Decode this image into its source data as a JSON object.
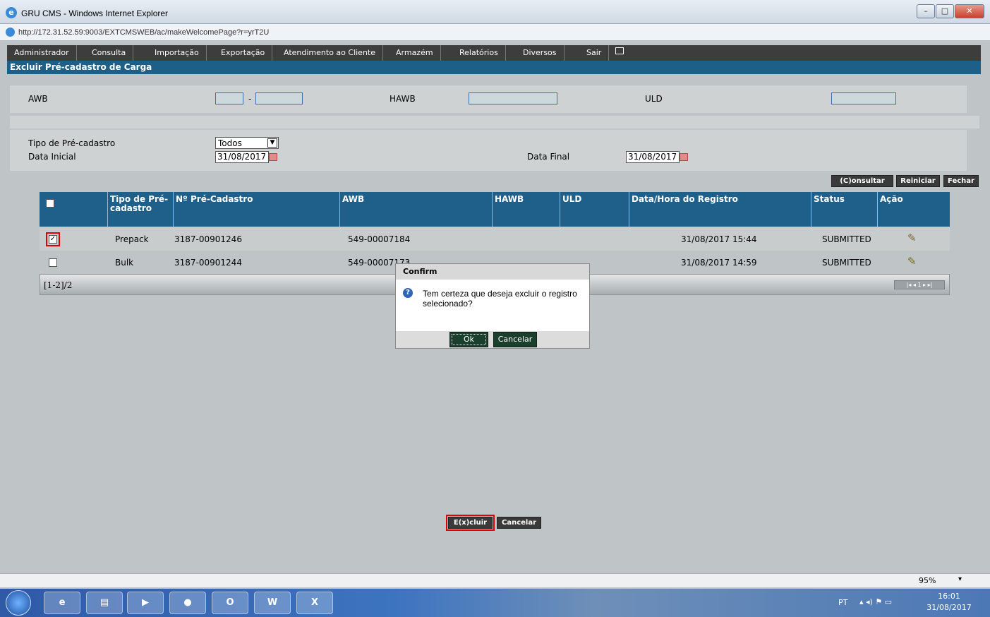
{
  "window": {
    "title": "GRU CMS - Windows Internet Explorer",
    "url": "http://172.31.52.59:9003/EXTCMSWEB/ac/makeWelcomePage?r=yrT2U"
  },
  "menu": [
    "Administrador",
    "Consulta",
    "Importação",
    "Exportação",
    "Atendimento ao Cliente",
    "Armazém",
    "Relatórios",
    "Diversos",
    "Sair"
  ],
  "section_title": "Excluir Pré-cadastro de Carga",
  "filters": {
    "awb_label": "AWB",
    "awb_sep": "-",
    "hawb_label": "HAWB",
    "uld_label": "ULD",
    "tipo_label": "Tipo de Pré-cadastro",
    "tipo_value": "Todos",
    "data_inicial_label": "Data Inicial",
    "data_inicial_value": "31/08/2017",
    "data_final_label": "Data Final",
    "data_final_value": "31/08/2017"
  },
  "buttons": {
    "consultar": "(C)onsultar",
    "reiniciar": "Reiniciar",
    "fechar": "Fechar",
    "excluir": "E(x)cluir",
    "cancelar": "Cancelar"
  },
  "table": {
    "headers": [
      "Tipo de Pré-cadastro",
      "Nº Pré-Cadastro",
      "AWB",
      "HAWB",
      "ULD",
      "Data/Hora do Registro",
      "Status",
      "Ação"
    ],
    "rows": [
      {
        "checked": true,
        "tipo": "Prepack",
        "numero": "3187-00901246",
        "awb": "549-00007184",
        "hawb": "",
        "uld": "",
        "data": "31/08/2017 15:44",
        "status": "SUBMITTED"
      },
      {
        "checked": false,
        "tipo": "Bulk",
        "numero": "3187-00901244",
        "awb": "549-00007173",
        "hawb": "",
        "uld": "",
        "data": "31/08/2017 14:59",
        "status": "SUBMITTED"
      }
    ],
    "footer": "[1-2]/2",
    "page": "1"
  },
  "dialog": {
    "title": "Confirm",
    "message": "Tem certeza que deseja excluir o registro selecionado?",
    "ok": "Ok",
    "cancel": "Cancelar"
  },
  "statusbar": {
    "zoom": "95%"
  },
  "taskbar": {
    "lang": "PT",
    "time": "16:01",
    "date": "31/08/2017"
  }
}
